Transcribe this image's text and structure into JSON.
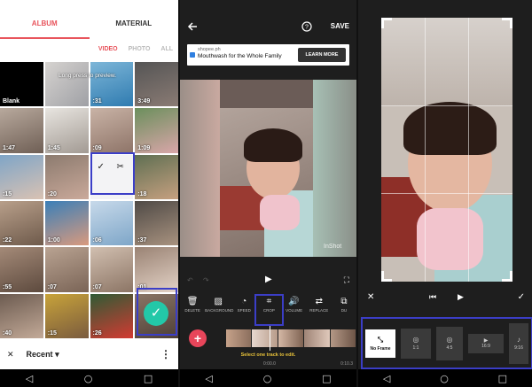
{
  "album": {
    "tabs": [
      "ALBUM",
      "MATERIAL"
    ],
    "subtabs": [
      "VIDEO",
      "PHOTO",
      "ALL"
    ],
    "tooltip": "Long press to preview.",
    "cells": [
      "Blank",
      "",
      ":31",
      "3:49",
      "1:47",
      "1:45",
      ":09",
      "1:09",
      ":15",
      ":20",
      "",
      ":18",
      ":22",
      "1:00",
      ":06",
      ":37",
      ":55",
      ":07",
      ":07",
      ":01",
      ":40",
      ":15",
      ":26",
      ""
    ],
    "recent_label": "Recent",
    "icons": {
      "close": "✕",
      "dropdown": "▾",
      "more": "⋮",
      "check": "✓",
      "scissors": "✂"
    }
  },
  "editor": {
    "save_label": "SAVE",
    "ad": {
      "source": "shopee.ph",
      "text": "Mouthwash for the Whole Family",
      "button": "LEARN MORE"
    },
    "watermark": "InShot",
    "tools": [
      {
        "icon": "🗑",
        "label": "DELETE"
      },
      {
        "icon": "▨",
        "label": "BACKGROUND"
      },
      {
        "icon": "◔",
        "label": "SPEED"
      },
      {
        "icon": "⌗",
        "label": "CROP"
      },
      {
        "icon": "🔊",
        "label": "VOLUME"
      },
      {
        "icon": "⇄",
        "label": "REPLACE"
      },
      {
        "icon": "⧉",
        "label": "DU"
      }
    ],
    "hint": "Select one track to edit.",
    "time_start": "0:00.0",
    "time_end": "0:10.3"
  },
  "crop": {
    "ratios": [
      {
        "label": "No Frame",
        "icon": "⤡"
      },
      {
        "label": "1:1",
        "icon": "◎"
      },
      {
        "label": "4:5",
        "icon": "◎"
      },
      {
        "label": "16:9",
        "icon": "▶"
      },
      {
        "label": "9:16",
        "icon": "♪"
      }
    ]
  },
  "colors": {
    "accent": "#e8545c",
    "highlight": "#3b3ec7",
    "fab": "#23c8a8",
    "add": "#e8455a"
  },
  "nav": {
    "back": "◁",
    "home": "○",
    "recents": "□"
  }
}
